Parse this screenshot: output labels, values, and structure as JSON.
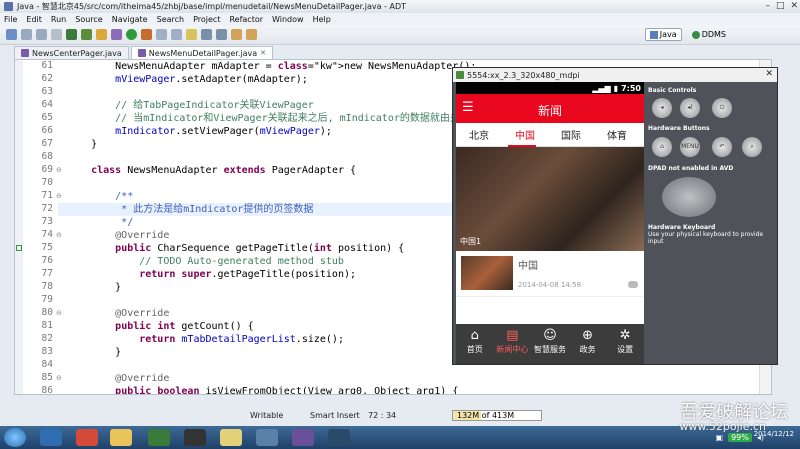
{
  "window": {
    "title": "Java - 智慧北京45/src/com/itheima45/zhbj/base/impl/menudetail/NewsMenuDetailPager.java - ADT"
  },
  "menu": [
    "File",
    "Edit",
    "Run",
    "Source",
    "Navigate",
    "Search",
    "Project",
    "Refactor",
    "Window",
    "Help"
  ],
  "perspectives": {
    "java": "Java",
    "ddms": "DDMS"
  },
  "tabs": [
    {
      "label": "NewsCenterPager.java",
      "active": false
    },
    {
      "label": "NewsMenuDetailPager.java",
      "active": true
    }
  ],
  "code": [
    {
      "n": "61",
      "text": "        NewsMenuAdapter mAdapter = new NewsMenuAdapter();"
    },
    {
      "n": "62",
      "text": "        mViewPager.setAdapter(mAdapter);"
    },
    {
      "n": "63",
      "text": ""
    },
    {
      "n": "64",
      "text": "        // 给TabPageIndicator关联ViewPager"
    },
    {
      "n": "65",
      "text": "        // 当mIndicator和ViewPager关联起来之后, mIndicator的数据就由关联上的V"
    },
    {
      "n": "66",
      "text": "        mIndicator.setViewPager(mViewPager);"
    },
    {
      "n": "67",
      "text": "    }"
    },
    {
      "n": "68",
      "text": ""
    },
    {
      "n": "69",
      "text": "    class NewsMenuAdapter extends PagerAdapter {"
    },
    {
      "n": "70",
      "text": ""
    },
    {
      "n": "71",
      "text": "        /**"
    },
    {
      "n": "72",
      "text": "         * 此方法是给mIndicator提供的页签数据"
    },
    {
      "n": "73",
      "text": "         */"
    },
    {
      "n": "74",
      "text": "        @Override"
    },
    {
      "n": "75",
      "text": "        public CharSequence getPageTitle(int position) {"
    },
    {
      "n": "76",
      "text": "            // TODO Auto-generated method stub"
    },
    {
      "n": "77",
      "text": "            return super.getPageTitle(position);"
    },
    {
      "n": "78",
      "text": "        }"
    },
    {
      "n": "79",
      "text": ""
    },
    {
      "n": "80",
      "text": "        @Override"
    },
    {
      "n": "81",
      "text": "        public int getCount() {"
    },
    {
      "n": "82",
      "text": "            return mTabDetailPagerList.size();"
    },
    {
      "n": "83",
      "text": "        }"
    },
    {
      "n": "84",
      "text": ""
    },
    {
      "n": "85",
      "text": "        @Override"
    },
    {
      "n": "86",
      "text": "        public boolean isViewFromObject(View arg0, Object arg1) {"
    }
  ],
  "status": {
    "writable": "Writable",
    "insert": "Smart Insert",
    "position": "72 : 34",
    "memory": "132M of 413M"
  },
  "emulator": {
    "title": "5554:xx_2.3_320x480_mdpi",
    "time": "7:50",
    "app_title": "新闻",
    "tabs": [
      "北京",
      "中国",
      "国际",
      "体育"
    ],
    "photo_caption": "中国1",
    "item": {
      "title": "中国",
      "date": "2014-04-08 14:58"
    },
    "nav": [
      "首页",
      "新闻中心",
      "智慧服务",
      "政务",
      "设置"
    ],
    "controls": {
      "basic": "Basic Controls",
      "hardware": "Hardware Buttons",
      "menu": "MENU",
      "dpad": "DPAD not enabled in AVD",
      "keyboard": "Hardware Keyboard",
      "keyboard_hint": "Use your physical keyboard to provide input"
    }
  },
  "taskbar": {
    "battery": "99%",
    "clock_time": "",
    "date": "2014/12/12"
  },
  "watermark": {
    "line1": "吾爱破解论坛",
    "line2": "www.52pojie.cn"
  }
}
